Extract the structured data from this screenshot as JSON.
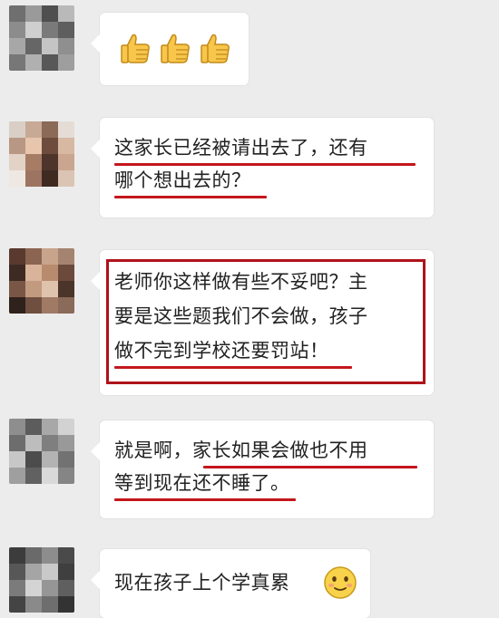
{
  "colors": {
    "background": "#ececec",
    "bubble": "#ffffff",
    "highlight": "#c4161c"
  },
  "messages": [
    {
      "id": "m1",
      "kind": "emoji",
      "emoji_icons": [
        "thumbs-up-icon",
        "thumbs-up-icon",
        "thumbs-up-icon"
      ]
    },
    {
      "id": "m2",
      "lines": [
        "这家长已经被请出去了，还有",
        "哪个想出去的？"
      ]
    },
    {
      "id": "m3",
      "lines": [
        "老师你这样做有些不妥吧？主",
        "要是这些题我们不会做，孩子",
        "做不完到学校还要罚站！"
      ]
    },
    {
      "id": "m4",
      "lines": [
        "就是啊，家长如果会做也不用",
        "等到现在还不睡了。"
      ]
    },
    {
      "id": "m5",
      "lines": [
        "现在孩子上个学真累"
      ],
      "trailing_icon": "smiling-face-icon"
    }
  ]
}
